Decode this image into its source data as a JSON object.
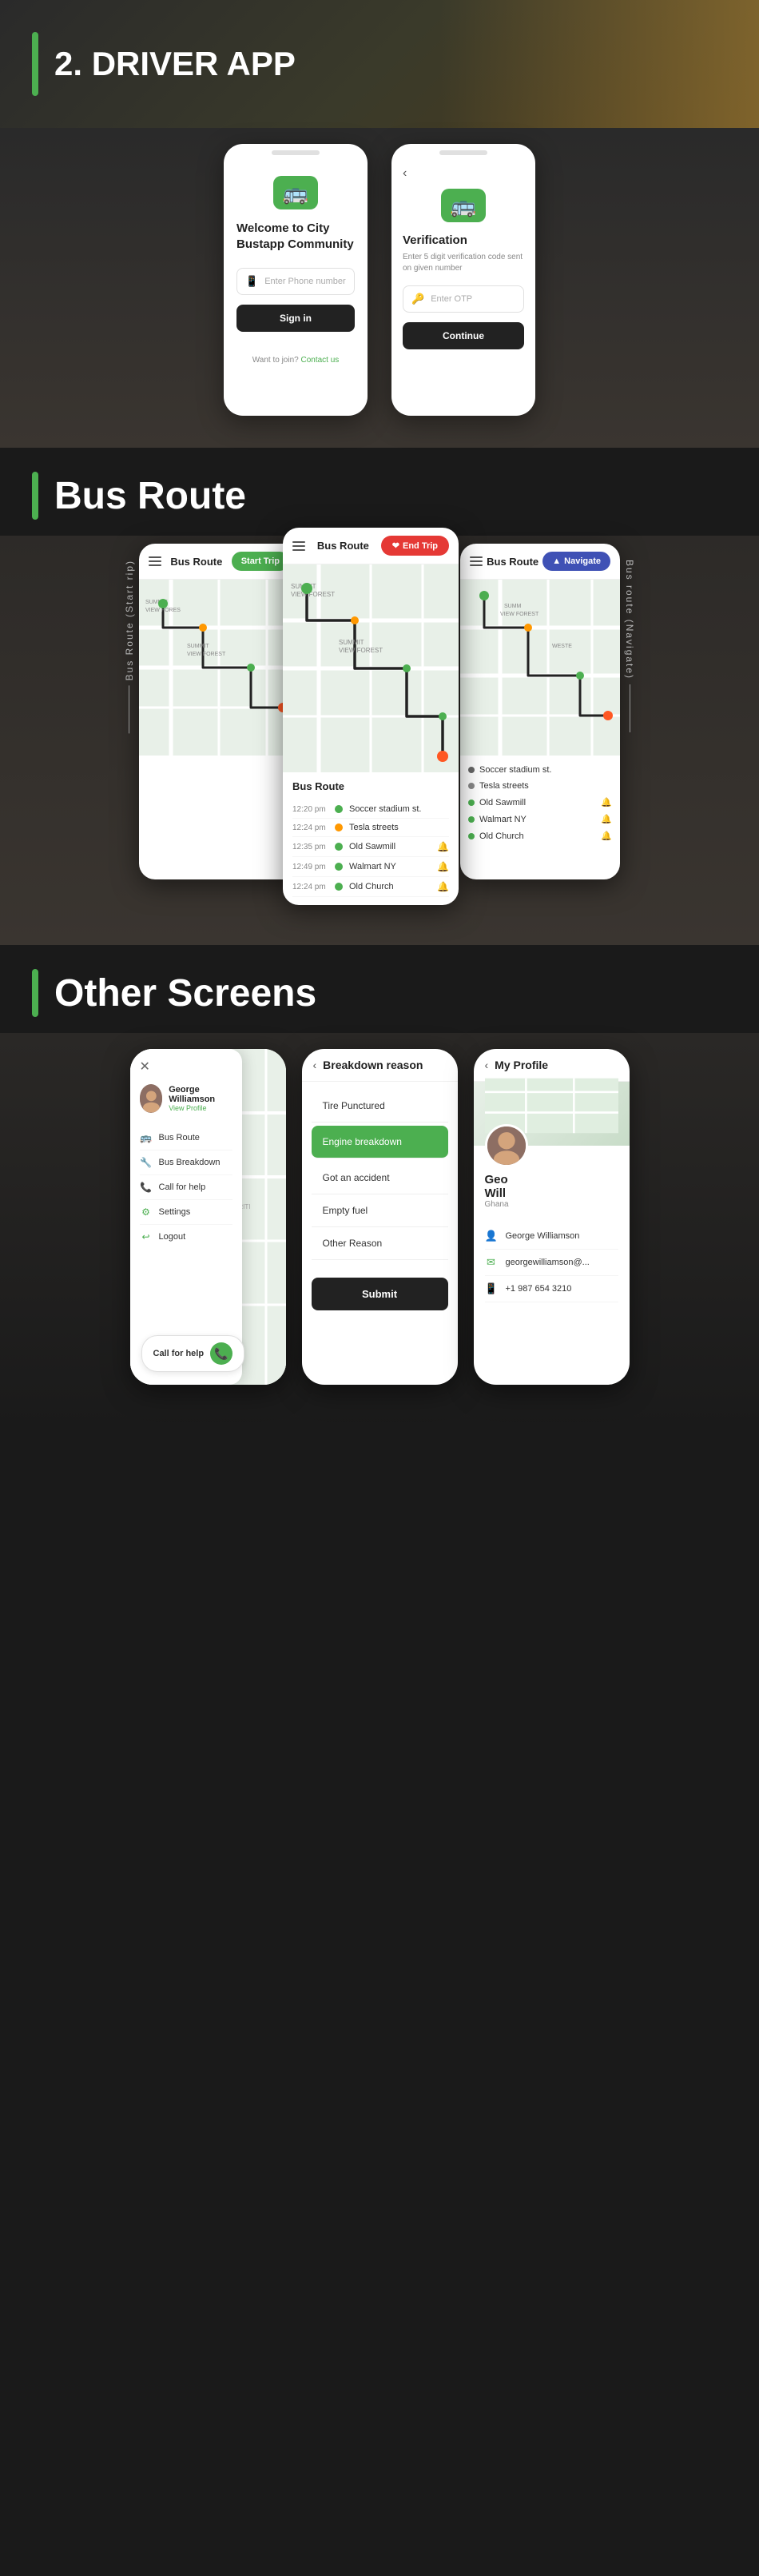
{
  "hero": {
    "title": "2. DRIVER APP"
  },
  "login_section": {
    "screen1": {
      "welcome": "Welcome to City Bustapp Community",
      "phone_placeholder": "Enter Phone number",
      "signin_btn": "Sign in",
      "footer_text": "Want to join?",
      "contact_link": "Contact us",
      "bus_emoji": "🚌"
    },
    "screen2": {
      "back": "‹",
      "title": "Verification",
      "subtitle": "Enter 5 digit verification code sent on given number",
      "otp_placeholder": "Enter OTP",
      "continue_btn": "Continue"
    }
  },
  "bus_route_section": {
    "title": "Bus Route",
    "side_label_left": "Bus Route (Start rip)",
    "side_label_right": "Bus route (Navigate)",
    "trip_label": "End Trip",
    "phone_left": {
      "header": "Bus Route",
      "btn": "Start Trip"
    },
    "phone_middle": {
      "header": "Bus Route",
      "btn": "End Trip",
      "route_title": "Bus Route",
      "stops": [
        {
          "time": "12:20 pm",
          "name": "Soccer stadium st.",
          "type": "green"
        },
        {
          "time": "12:24 pm",
          "name": "Tesla streets",
          "type": "orange"
        },
        {
          "time": "12:35 pm",
          "name": "Old Sawmill",
          "type": "green",
          "bell": true
        },
        {
          "time": "12:49 pm",
          "name": "Walmart NY",
          "type": "green",
          "bell": true
        },
        {
          "time": "12:24 pm",
          "name": "Old Church",
          "type": "green",
          "bell": true
        }
      ]
    },
    "phone_right": {
      "header": "Bus Route",
      "btn": "Navigate",
      "stops": [
        {
          "name": "Soccer stadium st.",
          "type": "green"
        },
        {
          "name": "Tesla streets",
          "type": "orange"
        },
        {
          "name": "Old Sawmill",
          "type": "green",
          "bell": true
        },
        {
          "name": "Walmart NY",
          "type": "green",
          "bell": true
        },
        {
          "name": "Old Church",
          "type": "green",
          "bell": true
        }
      ]
    }
  },
  "other_screens_section": {
    "title": "Other Screens",
    "phone1": {
      "close": "✕",
      "user_name": "George Williamson",
      "view_profile": "View Profile",
      "menu_items": [
        {
          "icon": "🚌",
          "label": "Bus Route"
        },
        {
          "icon": "🔧",
          "label": "Bus Breakdown"
        },
        {
          "icon": "📞",
          "label": "Call for help"
        },
        {
          "icon": "⚙",
          "label": "Settings"
        },
        {
          "icon": "↩",
          "label": "Logout"
        }
      ],
      "call_help": "Call for help"
    },
    "phone2": {
      "back": "‹",
      "title": "Breakdown reason",
      "options": [
        {
          "label": "Tire Punctured",
          "active": false
        },
        {
          "label": "Engine breakdown",
          "active": true
        },
        {
          "label": "Got an accident",
          "active": false
        },
        {
          "label": "Empty fuel",
          "active": false
        },
        {
          "label": "Other Reason",
          "active": false
        }
      ],
      "submit_btn": "Submit"
    },
    "phone3": {
      "back": "‹",
      "title": "My Profile",
      "user_name": "George Williamson",
      "status": "Ghana",
      "info": [
        {
          "icon": "👤",
          "text": "George Williamson"
        },
        {
          "icon": "✉",
          "text": "georgewilliamson@..."
        },
        {
          "icon": "📱",
          "text": "+1 987 654 3210"
        }
      ]
    }
  }
}
